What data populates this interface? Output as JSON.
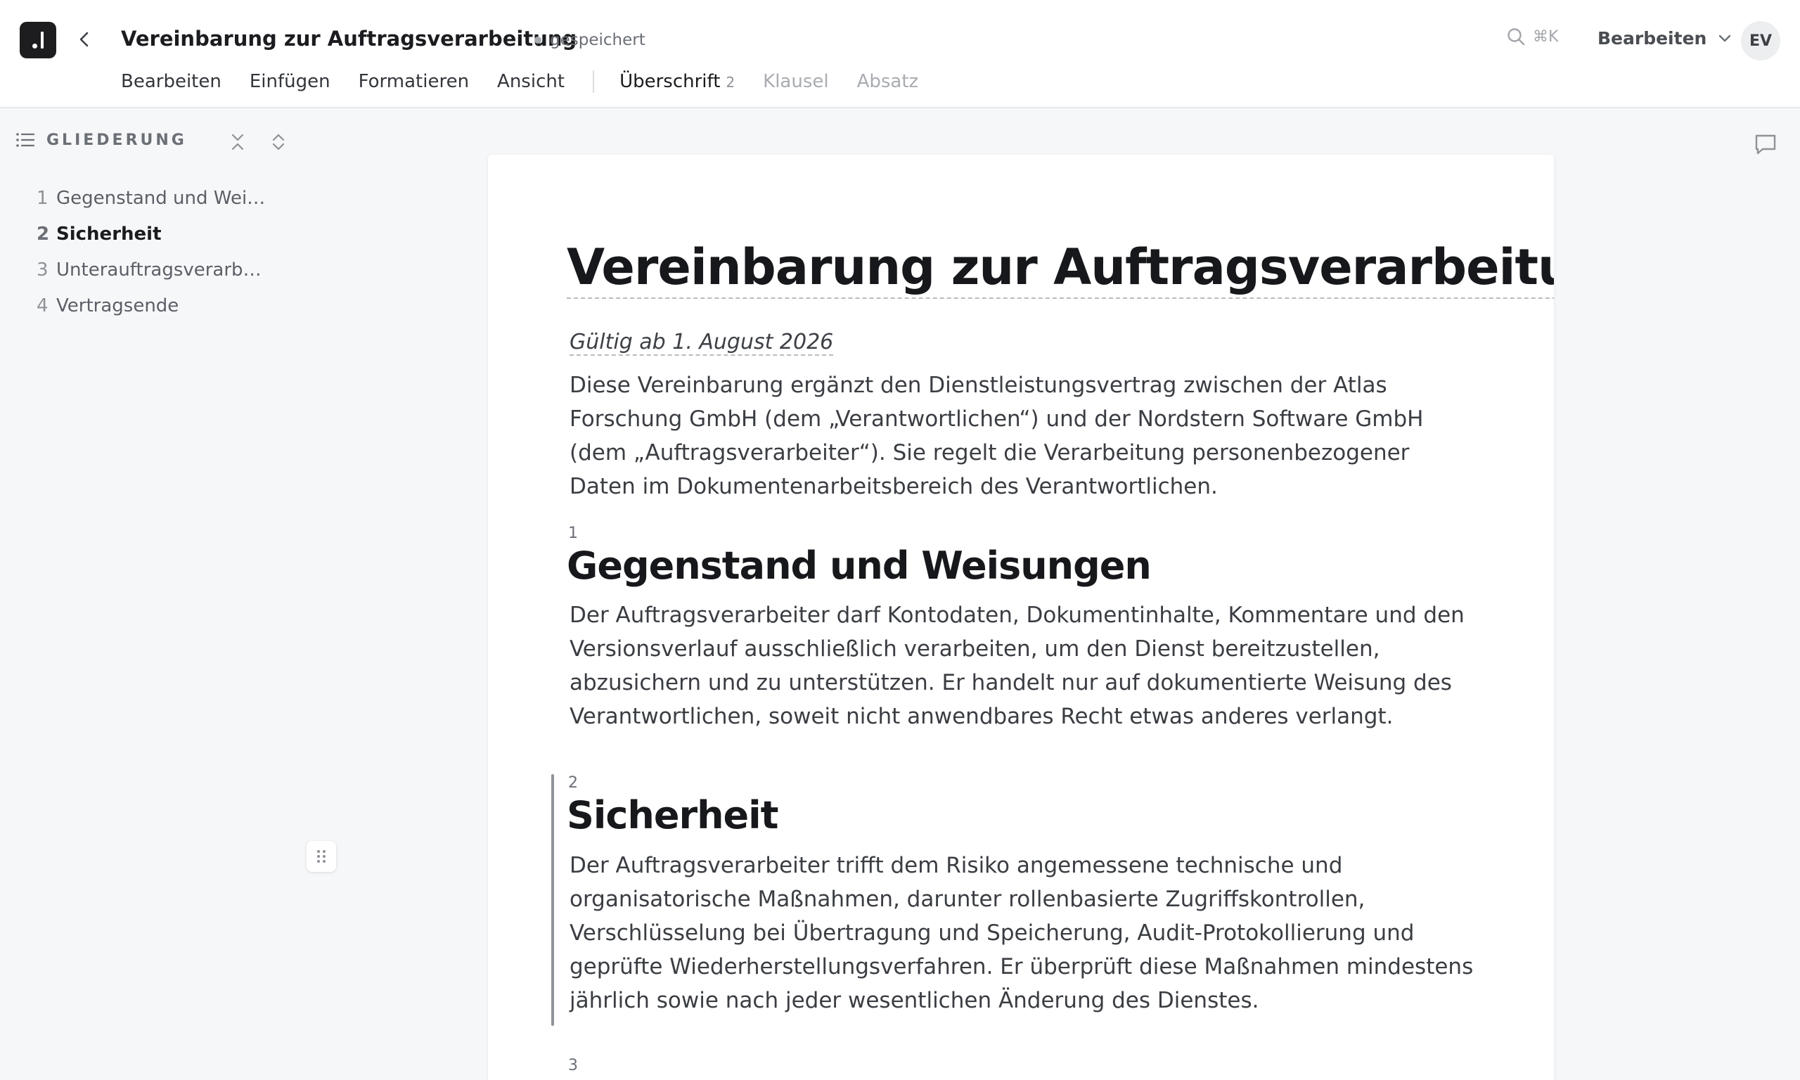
{
  "header": {
    "title": "Vereinbarung zur Auftragsverarbeitung",
    "save_status": "gespeichert",
    "search_shortcut": "⌘K",
    "mode_label": "Bearbeiten",
    "avatar_initials": "EV"
  },
  "menu": {
    "items": [
      "Bearbeiten",
      "Einfügen",
      "Formatieren",
      "Ansicht"
    ],
    "context": {
      "label": "Überschrift",
      "level": "2",
      "clause": "Klausel",
      "paragraph": "Absatz"
    }
  },
  "outline": {
    "title": "GLIEDERUNG",
    "items": [
      {
        "num": "1",
        "label": "Gegenstand und Weisungen"
      },
      {
        "num": "2",
        "label": "Sicherheit"
      },
      {
        "num": "3",
        "label": "Unterauftragsverarbeitung"
      },
      {
        "num": "4",
        "label": "Vertragsende"
      }
    ],
    "active_index": 1
  },
  "document": {
    "title": "Vereinbarung zur Auftragsverarbeitung",
    "valid_from": "Gültig ab 1. August 2026",
    "intro": "Diese Vereinbarung ergänzt den Dienstleistungsvertrag zwischen der Atlas Forschung GmbH (dem „Verantwortlichen“) und der Nordstern Software GmbH (dem „Auftragsverarbeiter“). Sie regelt die Verarbeitung personenbezogener Daten im Dokumentenarbeitsbereich des Verantwortlichen.",
    "sections": [
      {
        "num": "1",
        "heading": "Gegenstand und Weisungen",
        "text": "Der Auftragsverarbeiter darf Kontodaten, Dokumentinhalte, Kommentare und den Versionsverlauf ausschließlich verarbeiten, um den Dienst bereitzustellen, abzusichern und zu unterstützen. Er handelt nur auf dokumentierte Weisung des Verantwortlichen, soweit nicht anwendbares Recht etwas anderes verlangt."
      },
      {
        "num": "2",
        "heading": "Sicherheit",
        "text": "Der Auftragsverarbeiter trifft dem Risiko angemessene technische und organisatorische Maßnahmen, darunter rollenbasierte Zugriffskontrollen, Verschlüsselung bei Übertragung und Speicherung, Audit-Protokollierung und geprüfte Wiederherstellungsverfahren. Er überprüft diese Maßnahmen mindestens jährlich sowie nach jeder wesentlichen Änderung des Dienstes."
      },
      {
        "num": "3"
      }
    ]
  }
}
